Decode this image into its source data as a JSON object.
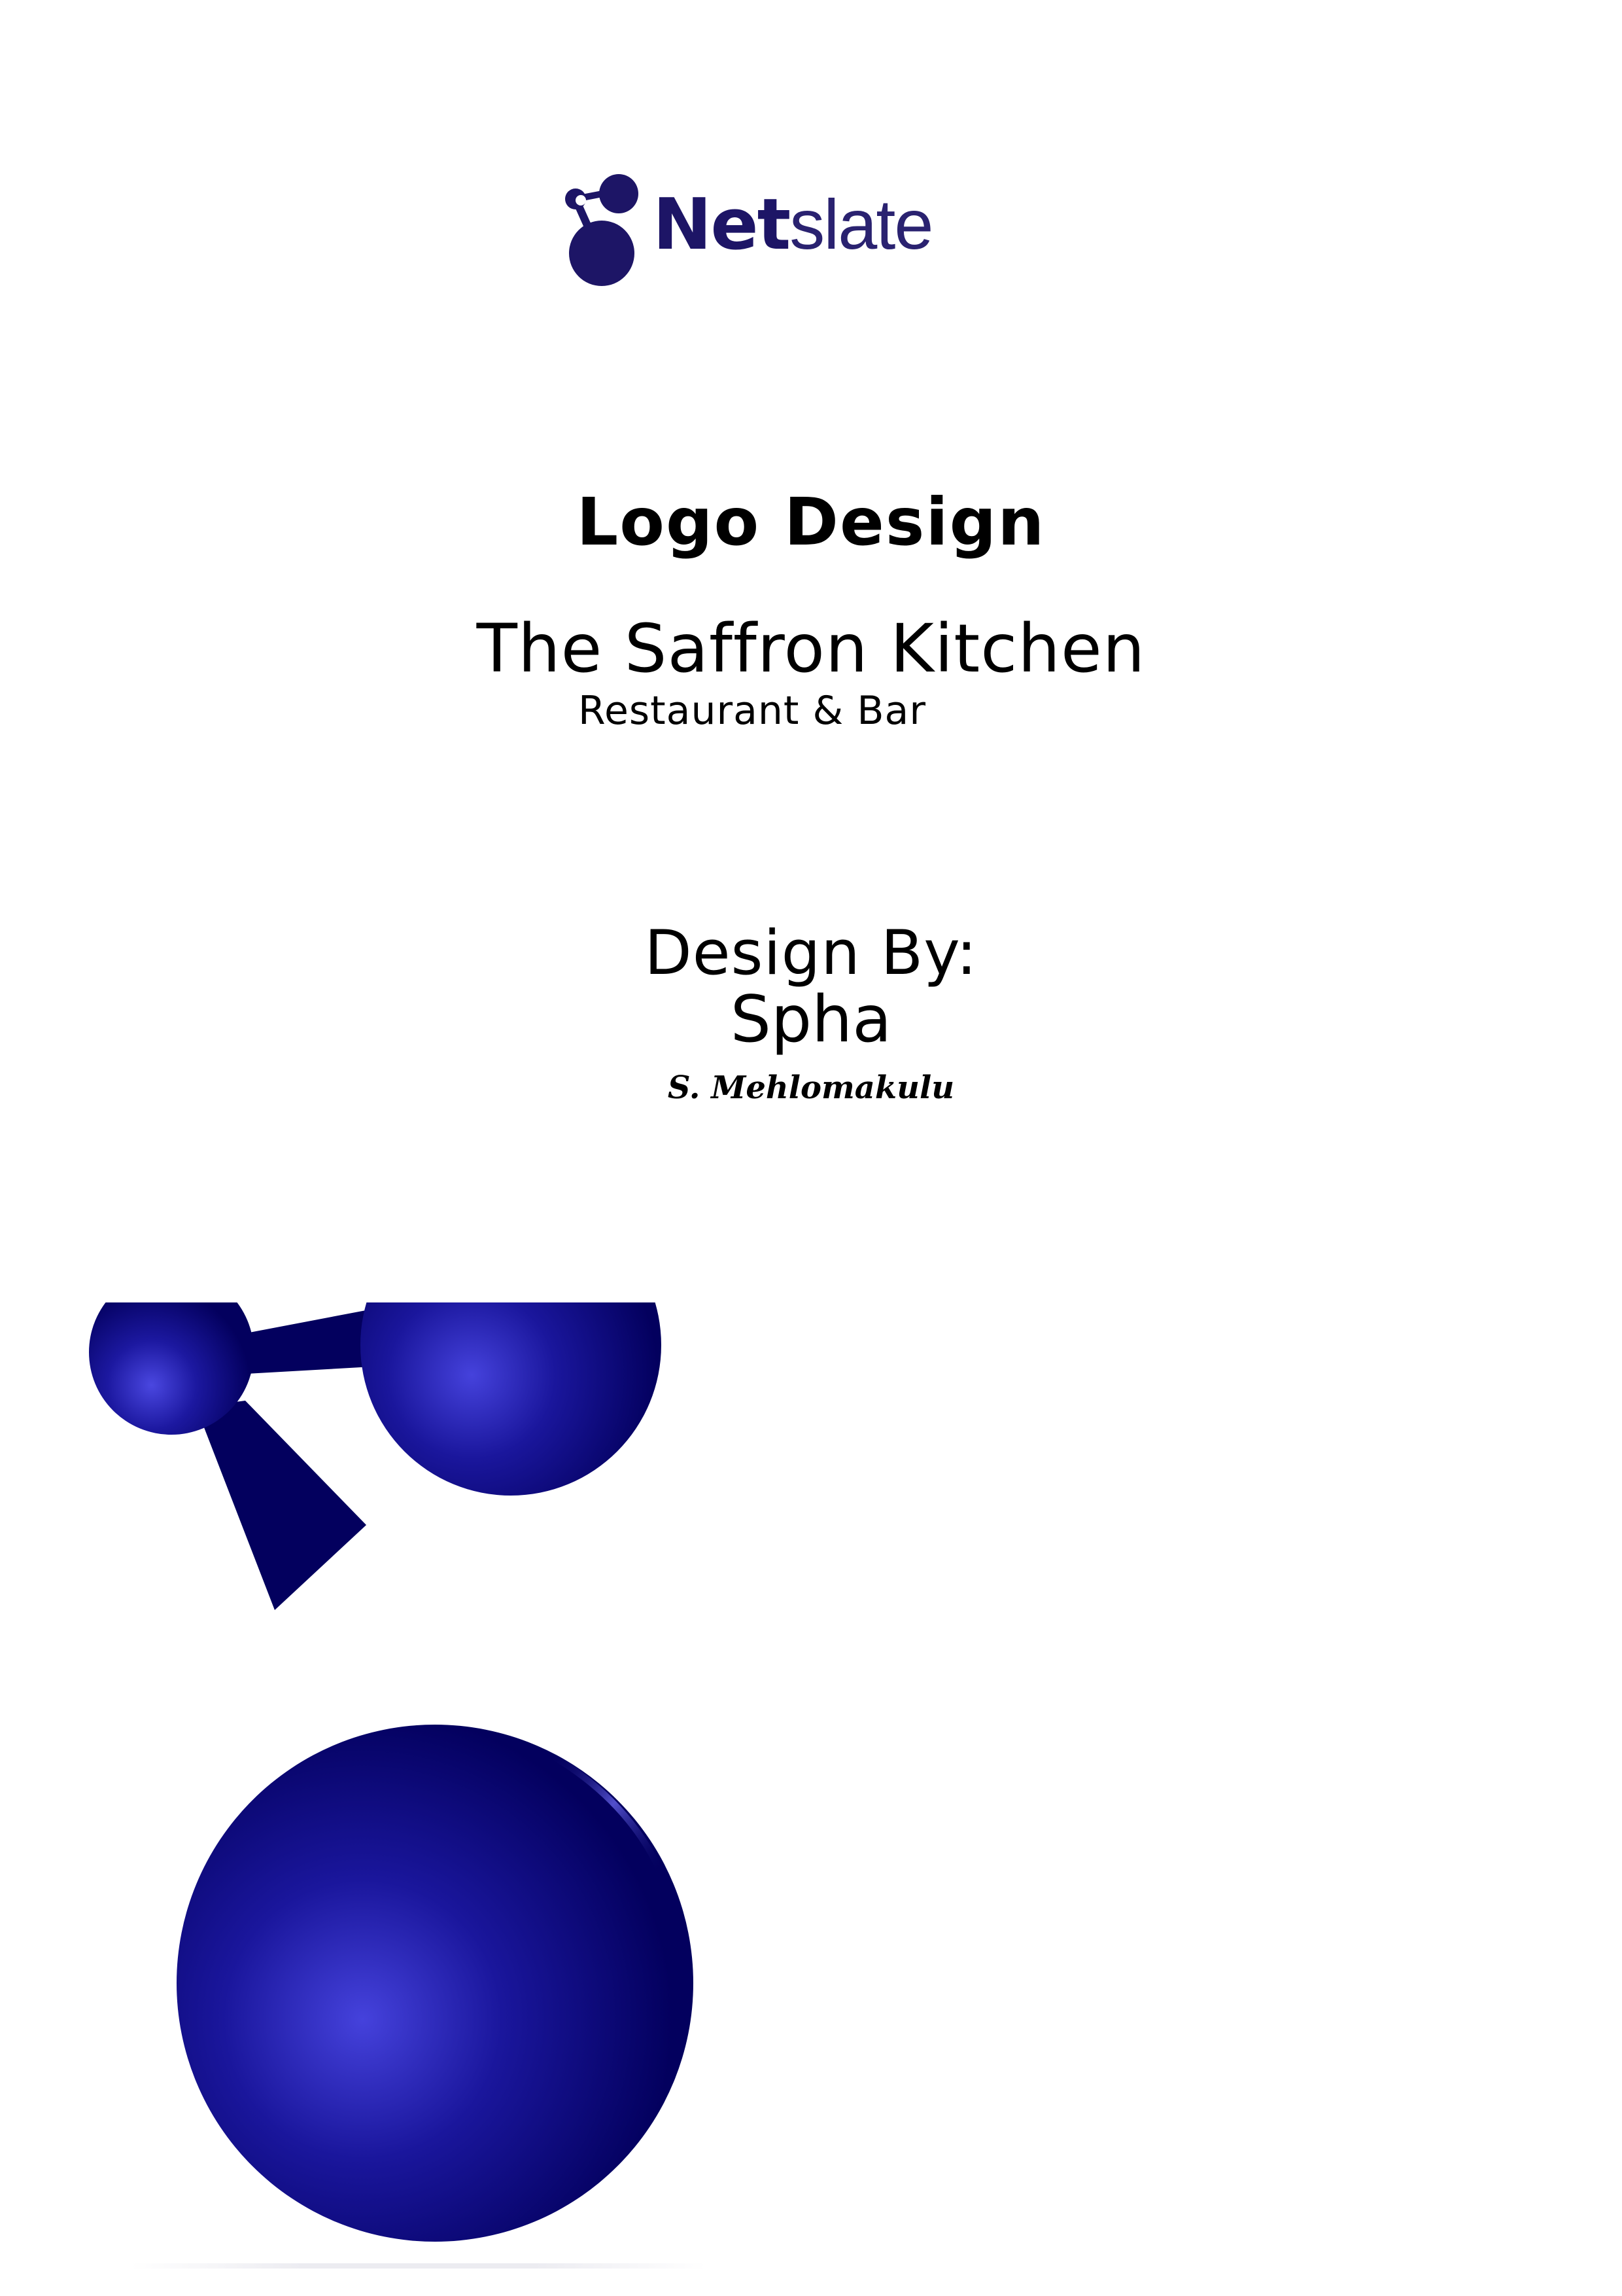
{
  "brand": {
    "word_bold": "Net",
    "word_light": "slate",
    "logo_icon": "netslate-molecule-icon",
    "color": "#1d1566"
  },
  "document": {
    "title": "Logo Design",
    "client_name": "The Saffron Kitchen",
    "client_subtitle": "Restaurant & Bar",
    "designer_label": "Design By:",
    "designer_name": "Spha",
    "signature": "S. Mehlomakulu"
  },
  "artwork": {
    "icon": "netslate-molecule-icon",
    "fill_dark": "#03005e",
    "fill_highlight": "#4a47e0"
  }
}
